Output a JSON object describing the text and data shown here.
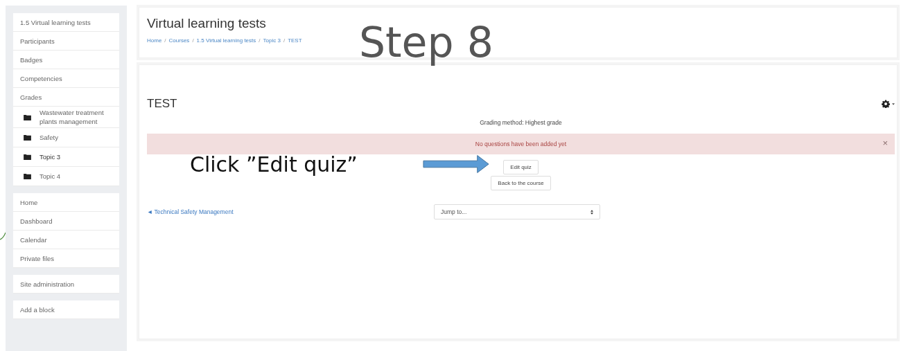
{
  "annotations": {
    "step": "Step 8",
    "instruction": "Click ”Edit quiz”"
  },
  "sidebar": {
    "groups": [
      {
        "items": [
          {
            "label": "1.5 Virtual learning tests",
            "kind": "link",
            "selected": false
          },
          {
            "label": "Participants",
            "kind": "link",
            "selected": false
          },
          {
            "label": "Badges",
            "kind": "link",
            "selected": false
          },
          {
            "label": "Competencies",
            "kind": "link",
            "selected": false
          },
          {
            "label": "Grades",
            "kind": "link",
            "selected": false
          },
          {
            "label": "Wastewater treatment plants management",
            "kind": "folder",
            "selected": false
          },
          {
            "label": "Safety",
            "kind": "folder",
            "selected": false
          },
          {
            "label": "Topic 3",
            "kind": "folder",
            "selected": true
          },
          {
            "label": "Topic 4",
            "kind": "folder",
            "selected": false
          }
        ]
      },
      {
        "items": [
          {
            "label": "Home",
            "kind": "link",
            "selected": false
          },
          {
            "label": "Dashboard",
            "kind": "link",
            "selected": false
          },
          {
            "label": "Calendar",
            "kind": "link",
            "selected": false
          },
          {
            "label": "Private files",
            "kind": "link",
            "selected": false
          }
        ]
      },
      {
        "items": [
          {
            "label": "Site administration",
            "kind": "link",
            "selected": false
          }
        ]
      },
      {
        "items": [
          {
            "label": "Add a block",
            "kind": "link",
            "selected": false
          }
        ]
      }
    ]
  },
  "header": {
    "title": "Virtual learning tests",
    "breadcrumb": [
      "Home",
      "Courses",
      "1.5 Virtual learning tests",
      "Topic 3",
      "TEST"
    ],
    "breadcrumb_separator": "/"
  },
  "activity": {
    "title": "TEST",
    "grading": "Grading method: Highest grade",
    "alert": {
      "text": "No questions have been added yet",
      "close": "×"
    },
    "buttons": [
      "Edit quiz",
      "Back to the course"
    ],
    "prev_link": "◄ Technical Safety Management",
    "jump": {
      "value": "Jump to..."
    }
  }
}
